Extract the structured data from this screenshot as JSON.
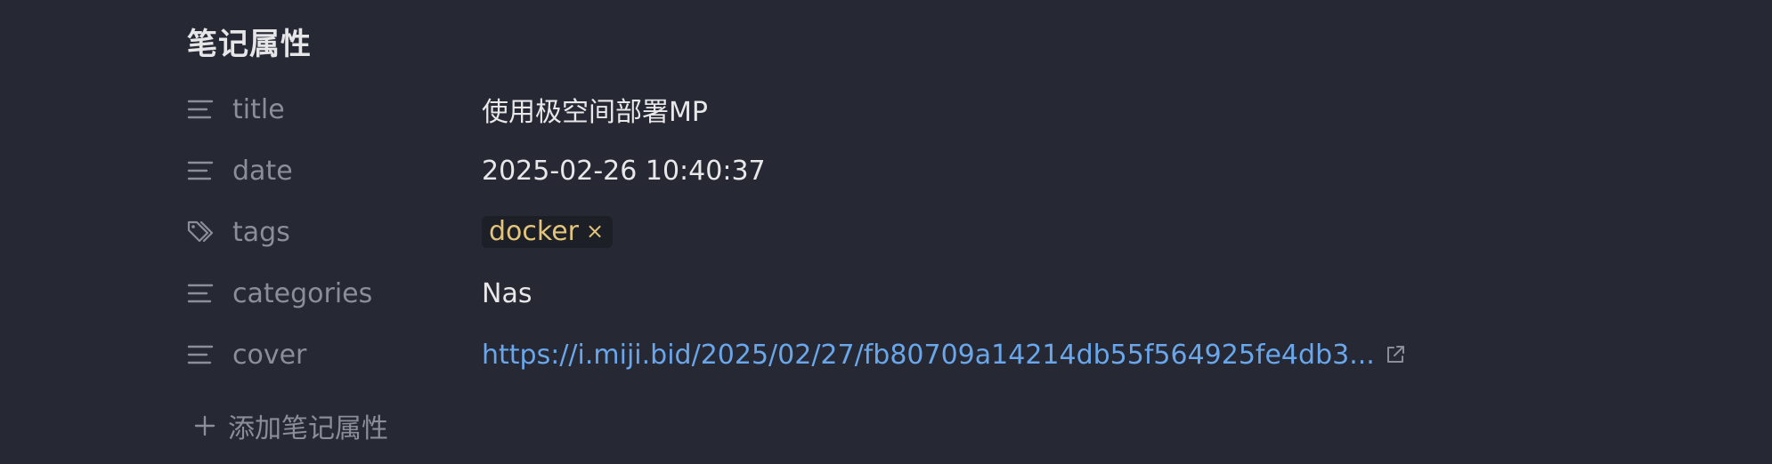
{
  "section": {
    "title": "笔记属性"
  },
  "properties": [
    {
      "key": "title",
      "value": "使用极空间部署MP",
      "icon": "text-lines-icon"
    },
    {
      "key": "date",
      "value": "2025-02-26 10:40:37",
      "icon": "text-lines-icon"
    },
    {
      "key": "tags",
      "tag": "docker",
      "remove": "×",
      "icon": "tag-icon"
    },
    {
      "key": "categories",
      "value": "Nas",
      "icon": "text-lines-icon"
    },
    {
      "key": "cover",
      "value": "https://i.miji.bid/2025/02/27/fb80709a14214db55f564925fe4db3...",
      "icon": "text-lines-icon"
    }
  ],
  "add_property": {
    "label": "添加笔记属性"
  },
  "colors": {
    "background": "#262833",
    "key_text": "#8b8e98",
    "value_text": "#e8e8ea",
    "tag_text": "#e2c47c",
    "link": "#6aa6ea"
  }
}
